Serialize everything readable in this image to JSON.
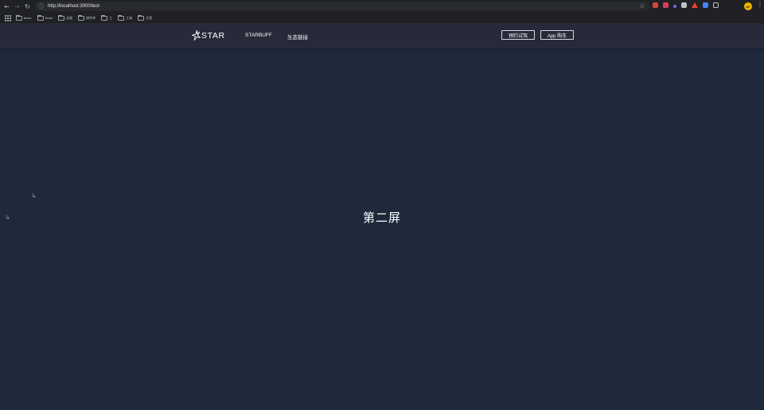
{
  "browser": {
    "url": "http://localhost:3000/test",
    "back_icon": "back-arrow-icon",
    "forward_icon": "forward-arrow-icon",
    "reload_icon": "reload-icon",
    "extension_colors": [
      "#d44638",
      "#d93d63",
      "#7b61ff",
      "#bdc1c6",
      "#ea4335",
      "#4285f4",
      "#bdc1c6"
    ],
    "profile_initials": "AP",
    "bookmarks": [
      "Mesc",
      "Node",
      "动画",
      "插件库",
      "工",
      "工具",
      "方案"
    ]
  },
  "site": {
    "logo_text": "STAR",
    "nav": [
      "STARBUFF",
      "生态链接"
    ],
    "buttons": [
      "预约试驾",
      "App 购车"
    ]
  },
  "main": {
    "title": "第二屏",
    "background": "#1e2a3c"
  }
}
